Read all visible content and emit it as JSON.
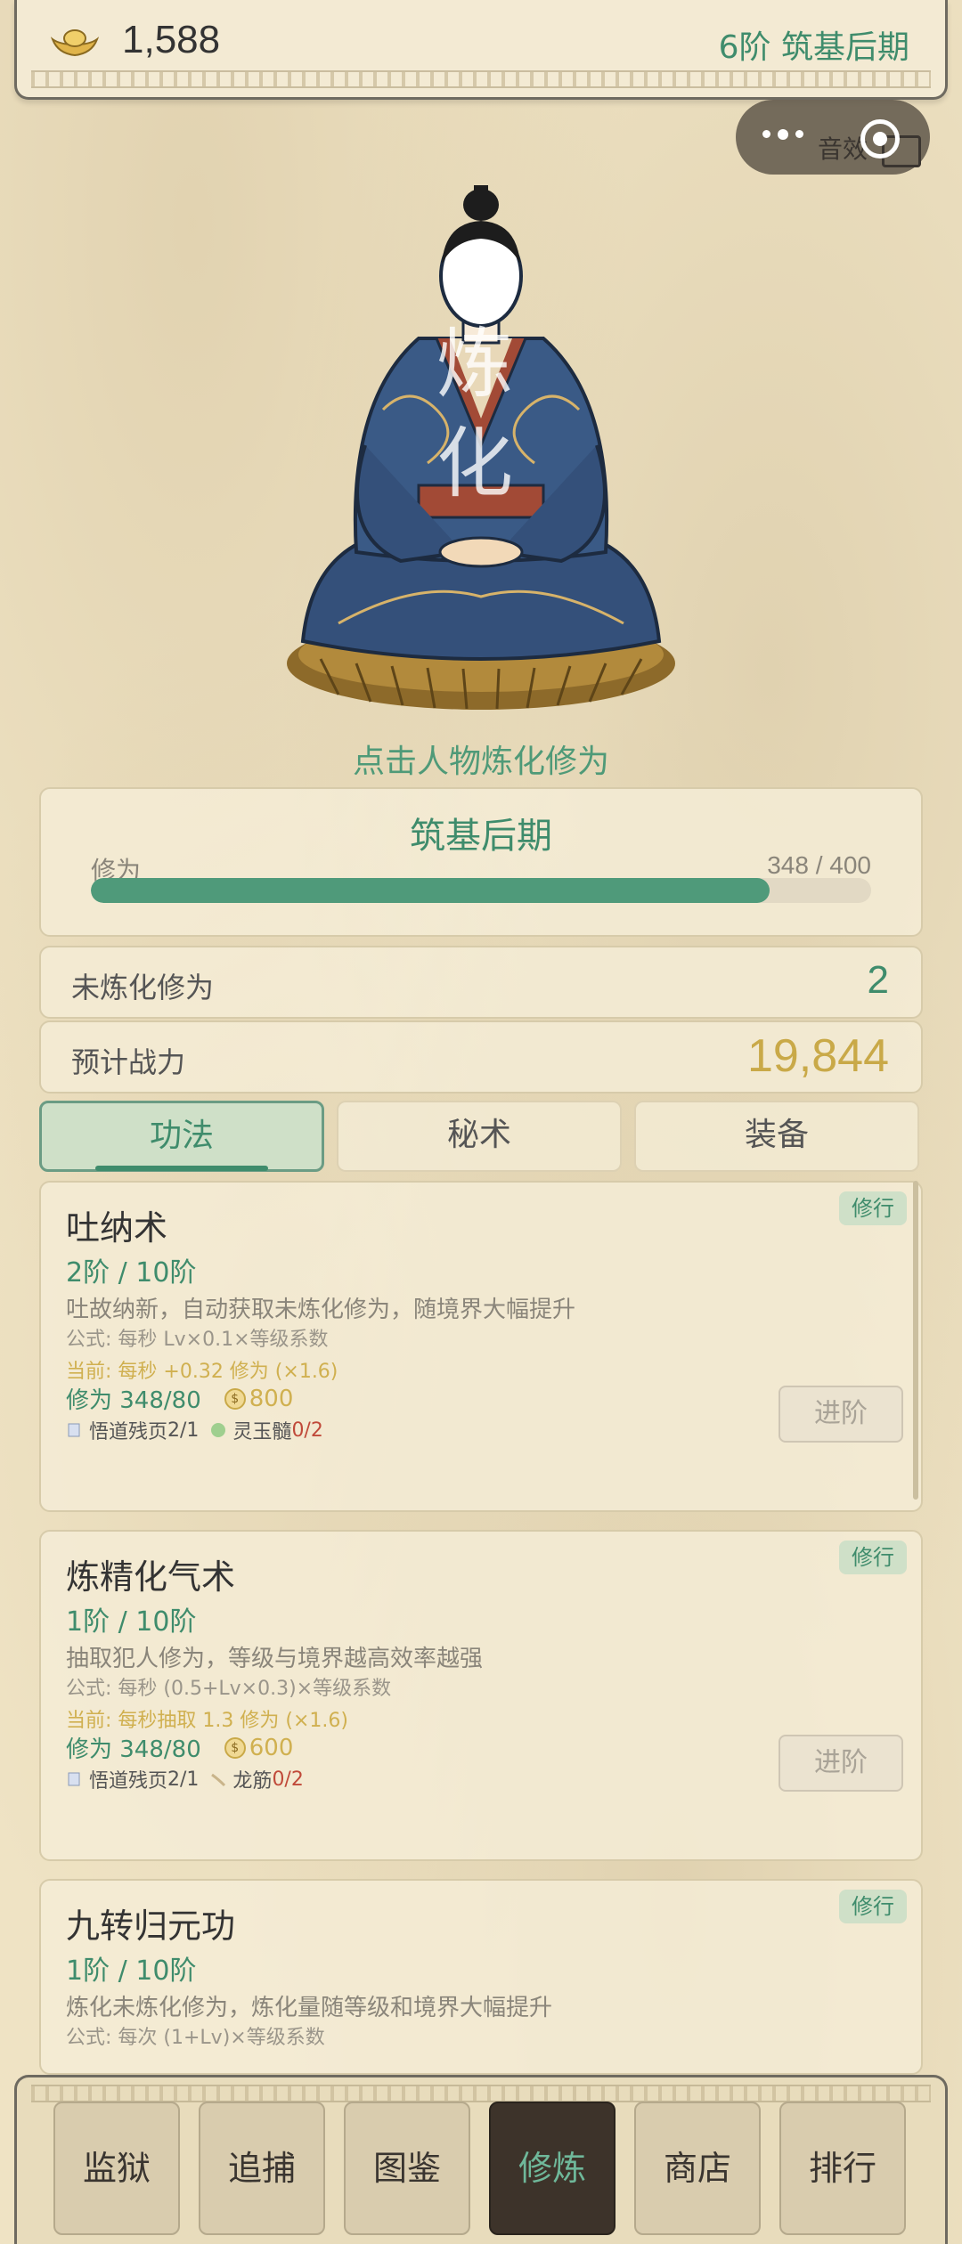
{
  "topbar": {
    "gold": "1,588",
    "realm": "6阶  筑基后期",
    "gold_icon": "gold-ingot-icon"
  },
  "capsule": {
    "sound_label": "音效"
  },
  "figure": {
    "refine_chars": [
      "炼",
      "化"
    ]
  },
  "hint": "点击人物炼化修为",
  "stage": {
    "title": "筑基后期",
    "xiuwei_label": "修为",
    "xiuwei_value": "348 / 400",
    "progress": 0.87
  },
  "unrefined": {
    "label": "未炼化修为",
    "value": "2"
  },
  "power": {
    "label": "预计战力",
    "value": "19,844"
  },
  "tabs": [
    {
      "label": "功法",
      "active": true
    },
    {
      "label": "秘术",
      "active": false
    },
    {
      "label": "装备",
      "active": false
    }
  ],
  "skills": [
    {
      "badge": "修行",
      "name": "吐纳术",
      "level": "2阶 / 10阶",
      "desc": "吐故纳新，自动获取未炼化修为，随境界大幅提升",
      "formula": "公式: 每秒 Lv×0.1×等级系数",
      "current": "当前: 每秒 +0.32 修为 (×1.6)",
      "xiuwei_cost": "修为 348/80",
      "money_cost": "800",
      "mat1": "悟道残页",
      "mat1_count": "2/1",
      "mat2": "灵玉髓",
      "mat2_count": "0/2",
      "advance": "进阶"
    },
    {
      "badge": "修行",
      "name": "炼精化气术",
      "level": "1阶 / 10阶",
      "desc": "抽取犯人修为，等级与境界越高效率越强",
      "formula": "公式: 每秒 (0.5+Lv×0.3)×等级系数",
      "current": "当前: 每秒抽取 1.3 修为 (×1.6)",
      "xiuwei_cost": "修为 348/80",
      "money_cost": "600",
      "mat1": "悟道残页",
      "mat1_count": "2/1",
      "mat2": "龙筋",
      "mat2_count": "0/2",
      "advance": "进阶"
    },
    {
      "badge": "修行",
      "name": "九转归元功",
      "level": "1阶 / 10阶",
      "desc": "炼化未炼化修为，炼化量随等级和境界大幅提升",
      "formula": "公式: 每次 (1+Lv)×等级系数"
    }
  ],
  "nav": [
    {
      "label": "监狱",
      "active": false
    },
    {
      "label": "追捕",
      "active": false
    },
    {
      "label": "图鉴",
      "active": false
    },
    {
      "label": "修炼",
      "active": true
    },
    {
      "label": "商店",
      "active": false
    },
    {
      "label": "排行",
      "active": false
    }
  ],
  "colors": {
    "accent": "#3f8c6c",
    "gold": "#c9a948",
    "red": "#c04a3a"
  }
}
